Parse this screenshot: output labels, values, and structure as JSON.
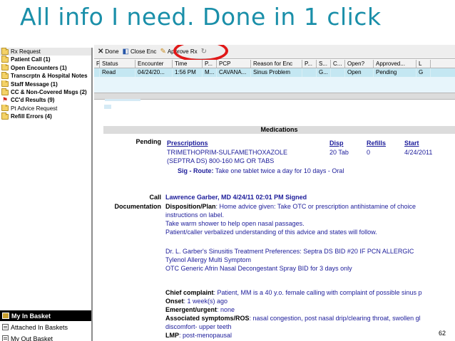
{
  "slide": {
    "title": "All info I need.  Done in 1 click",
    "page_number": "62"
  },
  "sidebar": {
    "folders": [
      {
        "label": "Rx Request",
        "bold": false,
        "icon": "folder-icon",
        "selected": true
      },
      {
        "label": "Patient Call (1)",
        "bold": true,
        "icon": "folder-icon"
      },
      {
        "label": "Open Encounters (1)",
        "bold": true,
        "icon": "folder-icon"
      },
      {
        "label": "Transcrptn & Hospital Notes",
        "bold": true,
        "icon": "folder-icon"
      },
      {
        "label": "Staff Message (1)",
        "bold": true,
        "icon": "folder-icon"
      },
      {
        "label": "CC & Non-Covered Msgs (2)",
        "bold": true,
        "icon": "folder-icon"
      },
      {
        "label": "CC'd Results (9)",
        "bold": true,
        "icon": "flag-icon"
      },
      {
        "label": "Pt Advice Request",
        "bold": false,
        "icon": "folder-icon"
      },
      {
        "label": "Refill Errors (4)",
        "bold": true,
        "icon": "folder-icon"
      }
    ],
    "my_in_basket": "My In Basket",
    "attached": "Attached In Baskets",
    "my_out": "My Out Basket"
  },
  "toolbar": {
    "done": "Done",
    "close_enc": "Close Enc",
    "approve_rx": "Approve Rx"
  },
  "grid": {
    "headers": [
      "P",
      "Status",
      "Encounter",
      "Time",
      "P...",
      "PCP",
      "Reason for Enc",
      "P...",
      "S...",
      "C...",
      "Open?",
      "Approved...",
      "L"
    ],
    "row": [
      "",
      "Read",
      "04/24/20...",
      "1:56 PM",
      "M...",
      "CAVANA...",
      "Sinus Problem",
      "",
      "G...",
      "",
      "Open",
      "Pending",
      "G"
    ]
  },
  "medications": {
    "section_title": "Medications",
    "pending_label": "Pending",
    "headers": {
      "prescriptions": "Prescriptions",
      "disp": "Disp",
      "refills": "Refills",
      "start": "Start"
    },
    "drug_line1": "TRIMETHOPRIM-SULFAMETHOXAZOLE",
    "drug_line2": "(SEPTRA DS) 800-160 MG OR TABS",
    "disp": "20 Tab",
    "refills": "0",
    "start": "4/24/2011",
    "sig_label": "Sig - Route:",
    "sig_text": " Take one tablet twice a day for 10 days - Oral"
  },
  "call_doc": {
    "label_line1": "Call",
    "label_line2": "Documentation",
    "signer": "Lawrence Garber, MD  4/24/11 02:01 PM  Signed",
    "disposition_label": "Disposition/Plan",
    "disposition_text": ": Home advice given:  Take OTC or prescription antihistamine of choice",
    "lines": [
      "instructions on label.",
      "Take warm shower to help open nasal passages.",
      "Patient/caller verbalized understanding of this advice and states will follow."
    ],
    "prefs": [
      "Dr. L. Garber's Sinusitis Treatment Preferences:  Septra DS BID #20 IF PCN ALLERGIC",
      "Tylenol Allergy Multi Symptom",
      "OTC Generic Afrin Nasal Decongestant Spray BID for 3 days only"
    ],
    "chief_label": "Chief complaint",
    "chief_text": ": Patient, MM is a 40 y.o. female calling with complaint of possible sinus p",
    "onset_label": "Onset",
    "onset_text": ": 1  week(s) ago",
    "emergent_label": "Emergent/urgent",
    "emergent_text": ": none",
    "assoc_label": "Associated symptoms/ROS",
    "assoc_text": ": nasal congestion, post nasal drip/clearing throat, swollen gl",
    "assoc_text2": "discomfort-  upper teeth",
    "lmp_label": "LMP",
    "lmp_text": ": post-menopausal"
  }
}
